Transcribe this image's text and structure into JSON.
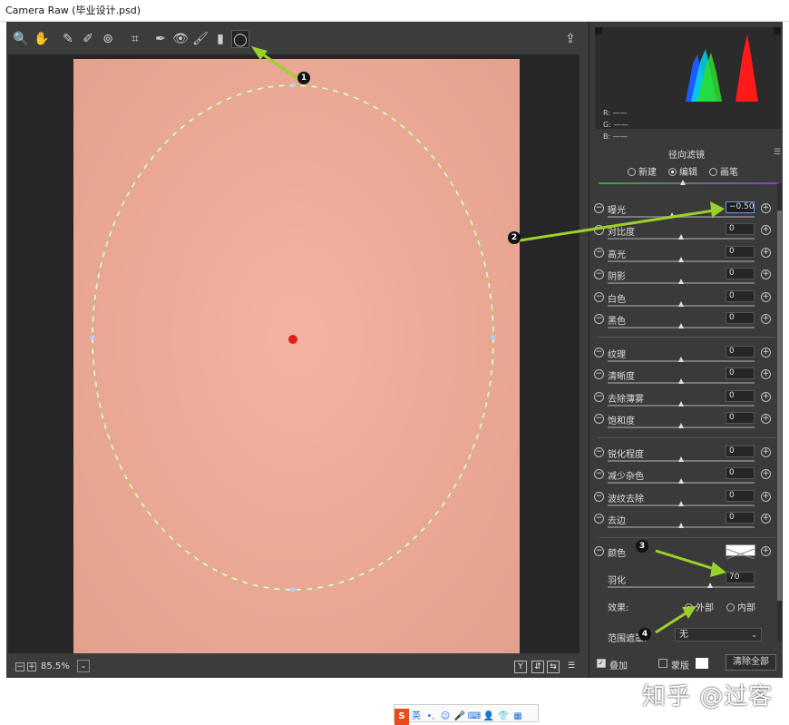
{
  "window": {
    "title": "Camera Raw (毕业设计.psd)"
  },
  "toolbar": {
    "tools": [
      {
        "icon": "zoom-icon",
        "glyph": "🔍"
      },
      {
        "icon": "hand-icon",
        "glyph": "✋"
      },
      {
        "icon": "white-balance-icon",
        "glyph": "✎"
      },
      {
        "icon": "color-sampler-icon",
        "glyph": "✐"
      },
      {
        "icon": "targeted-adjust-icon",
        "glyph": "⊚"
      },
      {
        "icon": "crop-icon",
        "glyph": "⌗"
      },
      {
        "icon": "spot-removal-icon",
        "glyph": "✒"
      },
      {
        "icon": "red-eye-icon",
        "glyph": "👁"
      },
      {
        "icon": "adjustment-brush-icon",
        "glyph": "🖌"
      },
      {
        "icon": "graduated-filter-icon",
        "glyph": "▮"
      },
      {
        "icon": "radial-filter-icon",
        "glyph": "◯"
      }
    ],
    "open_prefs_glyph": "⇪"
  },
  "canvas": {
    "zoom": "85.5%"
  },
  "annotations": [
    "1",
    "2",
    "3",
    "4"
  ],
  "panel": {
    "histogram": {
      "r_label": "R:",
      "g_label": "G:",
      "b_label": "B:",
      "r_value": "——",
      "g_value": "——",
      "b_value": "——"
    },
    "filter_title": "径向滤镜",
    "modes": {
      "new": "新建",
      "edit": "编辑",
      "brush": "画笔",
      "selected": "edit"
    },
    "sliders": [
      {
        "label": "曝光",
        "value": "−0.50",
        "pos": 0.44
      },
      {
        "label": "对比度",
        "value": "0",
        "pos": 0.5
      },
      {
        "label": "高光",
        "value": "0",
        "pos": 0.5
      },
      {
        "label": "阴影",
        "value": "0",
        "pos": 0.5
      },
      {
        "label": "白色",
        "value": "0",
        "pos": 0.5
      },
      {
        "label": "黑色",
        "value": "0",
        "pos": 0.5
      },
      {
        "label": "纹理",
        "value": "0",
        "pos": 0.5
      },
      {
        "label": "清晰度",
        "value": "0",
        "pos": 0.5
      },
      {
        "label": "去除薄雾",
        "value": "0",
        "pos": 0.5
      },
      {
        "label": "饱和度",
        "value": "0",
        "pos": 0.5
      },
      {
        "label": "锐化程度",
        "value": "0",
        "pos": 0.5
      },
      {
        "label": "减少杂色",
        "value": "0",
        "pos": 0.5
      },
      {
        "label": "波纹去除",
        "value": "0",
        "pos": 0.5
      },
      {
        "label": "去边",
        "value": "0",
        "pos": 0.5
      }
    ],
    "color_label": "颜色",
    "feather": {
      "label": "羽化",
      "value": "70",
      "pos": 0.7
    },
    "effect": {
      "label": "效果:",
      "outside": "外部",
      "inside": "内部",
      "selected": "outside"
    },
    "range_mask": {
      "label": "范围遮罩:",
      "value": "无"
    },
    "overlay_label": "叠加",
    "mask_label": "蒙版",
    "clear_all": "清除全部"
  },
  "ime_bar": {
    "logo": "S",
    "lang": "英"
  },
  "watermark": "知乎 @过客"
}
